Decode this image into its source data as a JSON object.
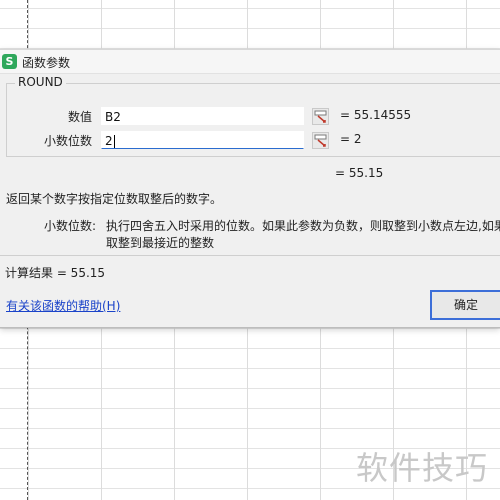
{
  "dialog": {
    "title": "函数参数",
    "function_name": "ROUND",
    "args": [
      {
        "label": "数值",
        "value": "B2",
        "result": "= 55.14555"
      },
      {
        "label": "小数位数",
        "value": "2",
        "result": "= 2"
      }
    ],
    "formula_result": "= 55.15",
    "description": "返回某个数字按指定位数取整后的数字。",
    "arg_help_label": "小数位数:",
    "arg_help_text_line1": "执行四舍五入时采用的位数。如果此参数为负数，则取整到小数点左边,如果",
    "arg_help_text_line2": "取整到最接近的整数",
    "calc_result": "计算结果 =  55.15",
    "help_link": "有关该函数的帮助(H)",
    "ok_label": "确定"
  },
  "app_icon_glyph": "S",
  "watermark": "软件技巧",
  "colors": {
    "link": "#1a43c9",
    "app_icon": "#2fa85c",
    "focus": "#3c6ed8"
  }
}
